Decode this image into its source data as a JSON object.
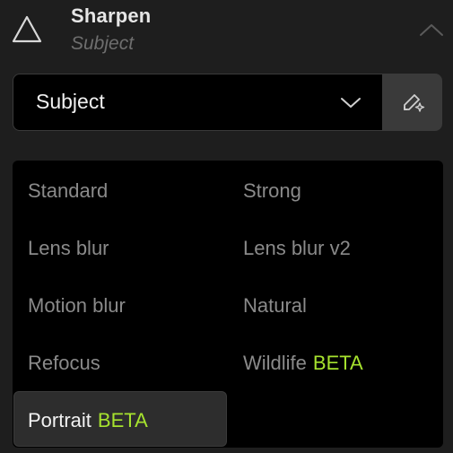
{
  "header": {
    "title": "Sharpen",
    "subtitle": "Subject",
    "tool_icon": "triangle-icon",
    "collapse_icon": "chevron-up-icon"
  },
  "mode_select": {
    "value": "Subject",
    "icon": "chevron-down-icon"
  },
  "brush_button": {
    "icon": "brush-sparkle-icon"
  },
  "models": {
    "beta_label": "BETA",
    "options": [
      {
        "label": "Standard",
        "beta": false,
        "selected": false
      },
      {
        "label": "Strong",
        "beta": false,
        "selected": false
      },
      {
        "label": "Lens blur",
        "beta": false,
        "selected": false
      },
      {
        "label": "Lens blur v2",
        "beta": false,
        "selected": false
      },
      {
        "label": "Motion blur",
        "beta": false,
        "selected": false
      },
      {
        "label": "Natural",
        "beta": false,
        "selected": false
      },
      {
        "label": "Refocus",
        "beta": false,
        "selected": false
      },
      {
        "label": "Wildlife",
        "beta": true,
        "selected": false
      },
      {
        "label": "Portrait",
        "beta": true,
        "selected": true
      }
    ]
  },
  "colors": {
    "background": "#1e1e1e",
    "dropdown_bg": "#000000",
    "beta_accent": "#a6e22e",
    "muted_text": "#8a8a8a"
  }
}
